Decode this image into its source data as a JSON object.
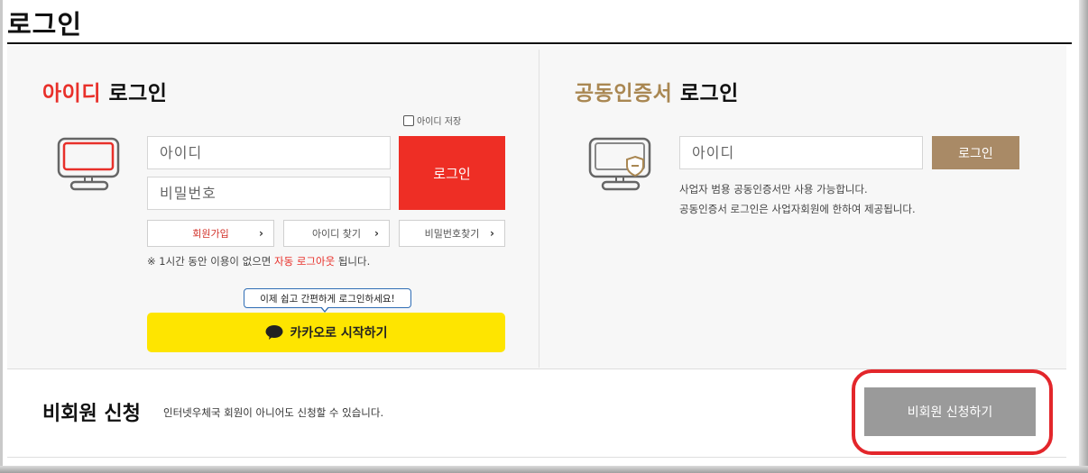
{
  "page": {
    "title": "로그인"
  },
  "id_login": {
    "title_accent": "아이디",
    "title_rest": " 로그인",
    "save_label": "아이디 저장",
    "id_placeholder": "아이디",
    "pw_placeholder": "비밀번호",
    "login_button": "로그인",
    "links": [
      {
        "label": "회원가입"
      },
      {
        "label": "아이디 찾기"
      },
      {
        "label": "비밀번호찾기"
      }
    ],
    "notice_prefix": "※ 1시간 동안 이용이 없으면 ",
    "notice_highlight": "자동 로그아웃",
    "notice_suffix": " 됩니다.",
    "kakao_bubble": "이제 쉽고 간편하게 로그인하세요!",
    "kakao_button": "카카오로 시작하기"
  },
  "cert_login": {
    "title_accent": "공동인증서",
    "title_rest": " 로그인",
    "id_placeholder": "아이디",
    "login_button": "로그인",
    "desc_line1": "사업자 범용 공동인증서만 사용 가능합니다.",
    "desc_line2": "공동인증서 로그인은 사업자회원에 한하여 제공됩니다."
  },
  "guest": {
    "title": "비회원 신청",
    "description": "인터넷우체국 회원이 아니어도 신청할 수 있습니다.",
    "button": "비회원 신청하기"
  },
  "colors": {
    "accent_red": "#ee2e25",
    "accent_gold": "#a98a66",
    "kakao_yellow": "#fee500",
    "highlight_red": "#e3262b"
  }
}
